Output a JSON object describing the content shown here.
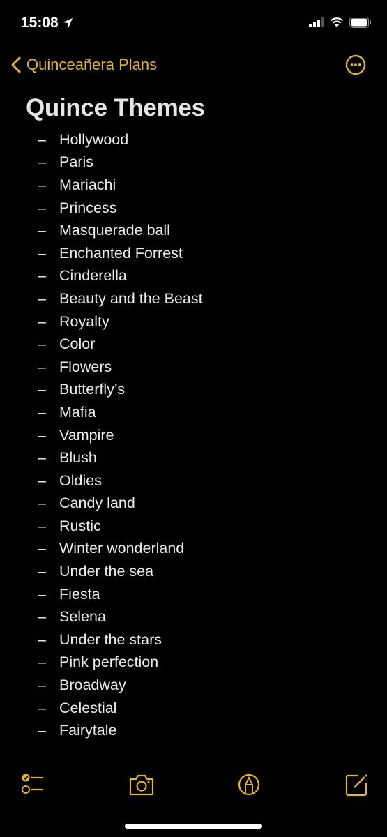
{
  "status_bar": {
    "time": "15:08",
    "location_icon": "location-arrow-icon",
    "signal_icon": "signal-icon",
    "wifi_icon": "wifi-icon",
    "battery_icon": "battery-icon"
  },
  "nav": {
    "back_label": "Quinceañera Plans",
    "more_icon": "ellipsis-circle-icon"
  },
  "accent_color": "#e3b23c",
  "note": {
    "title": "Quince Themes",
    "bullet": "–",
    "items": [
      "Hollywood",
      "Paris",
      "Mariachi",
      "Princess",
      "Masquerade ball",
      "Enchanted Forrest",
      "Cinderella",
      "Beauty and the Beast",
      "Royalty",
      "Color",
      "Flowers",
      "Butterfly’s",
      "Mafia",
      "Vampire",
      "Blush",
      "Oldies",
      "Candy land",
      "Rustic",
      "Winter wonderland",
      "Under the sea",
      "Fiesta",
      "Selena",
      "Under the stars",
      "Pink perfection",
      "Broadway",
      "Celestial",
      "Fairytale"
    ]
  },
  "toolbar": {
    "checklist_icon": "checklist-icon",
    "camera_icon": "camera-icon",
    "markup_icon": "markup-pen-icon",
    "compose_icon": "compose-icon"
  }
}
